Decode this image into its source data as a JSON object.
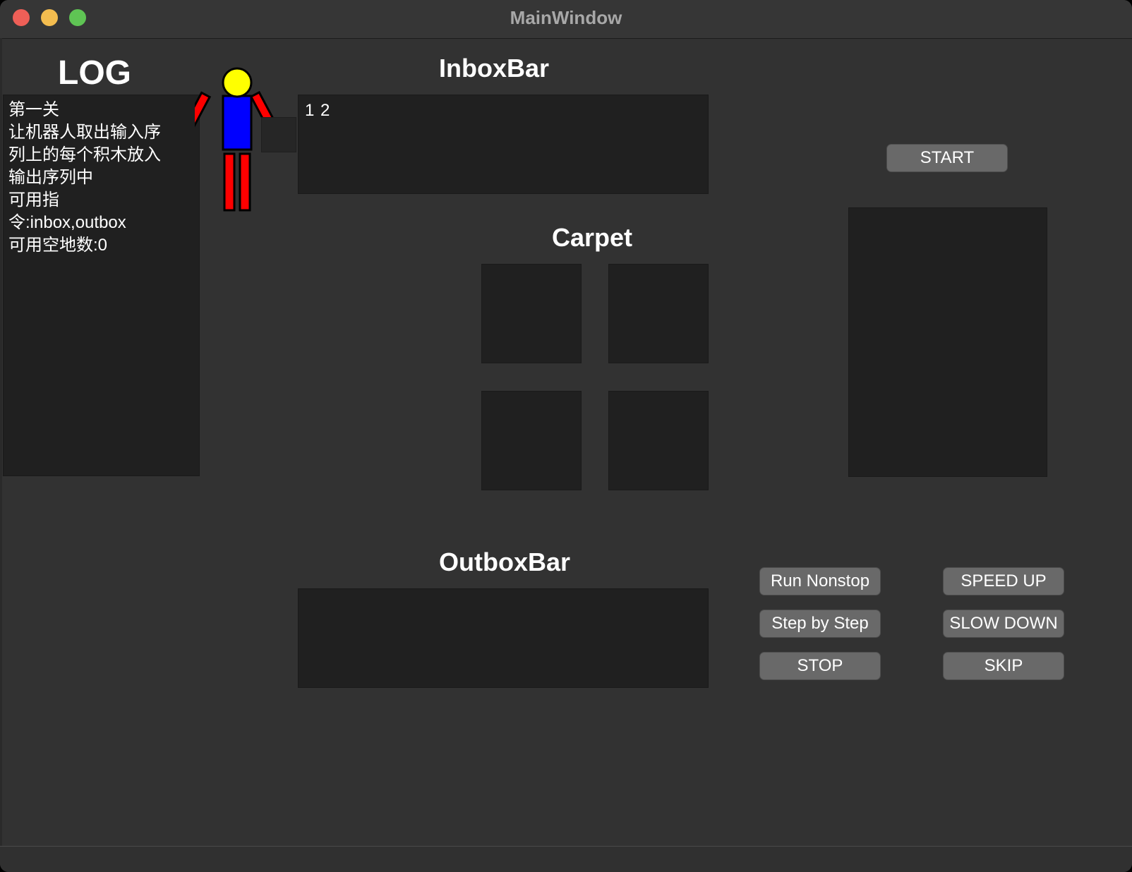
{
  "window": {
    "title": "MainWindow"
  },
  "log": {
    "heading": "LOG",
    "lines": [
      "第一关",
      "让机器人取出输入序",
      "列上的每个积木放入",
      "输出序列中",
      "可用指",
      "令:inbox,outbox",
      "可用空地数:0"
    ]
  },
  "inbox": {
    "heading": "InboxBar",
    "content": "1 2"
  },
  "carpet": {
    "heading": "Carpet"
  },
  "outbox": {
    "heading": "OutboxBar",
    "content": ""
  },
  "controls": {
    "start": "START",
    "run_nonstop": "Run Nonstop",
    "speed_up": "SPEED UP",
    "step_by_step": "Step by Step",
    "slow_down": "SLOW DOWN",
    "stop": "STOP",
    "skip": "SKIP"
  },
  "colors": {
    "robot_head": "#ffff00",
    "robot_body": "#0000ff",
    "robot_limbs": "#ff0000"
  }
}
